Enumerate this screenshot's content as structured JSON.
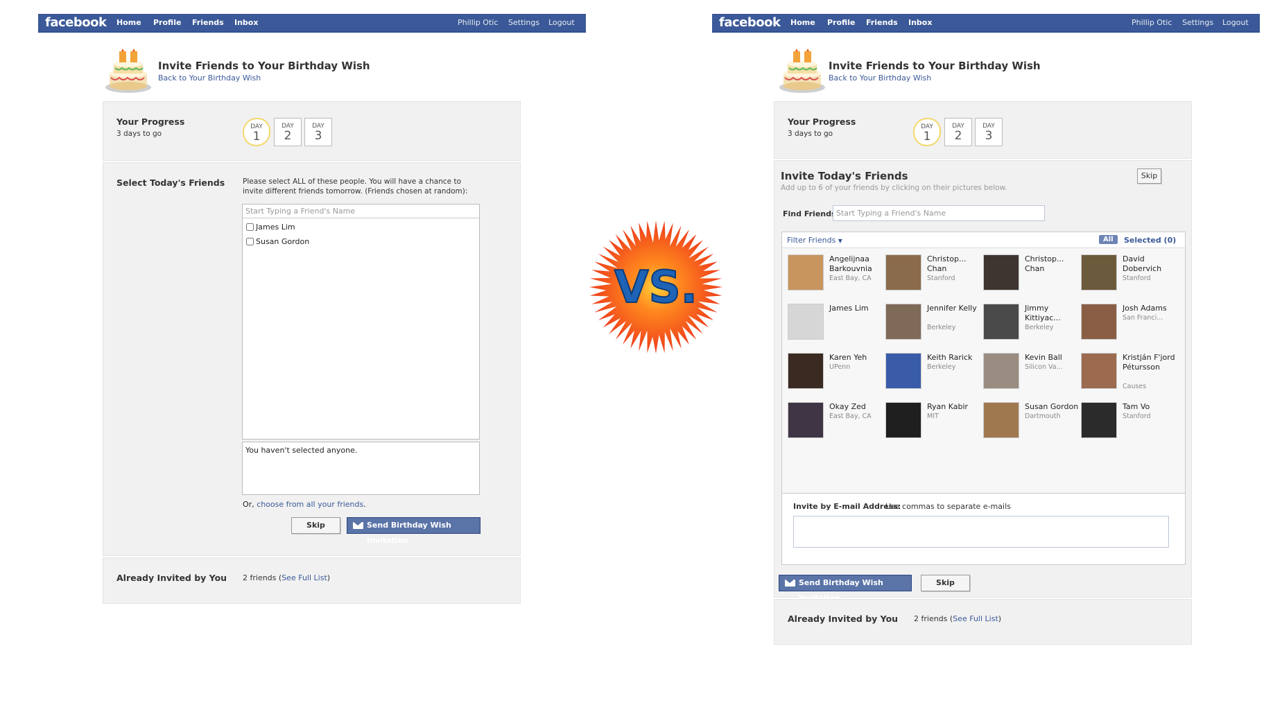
{
  "colors": {
    "brand": "#3b5998",
    "panel_bg": "#f1f1f1",
    "highlight_ring": "#f3d86a",
    "vs_fill": "#1e63b5",
    "burst": "#f04b1c"
  },
  "vs": {
    "text": "VS."
  },
  "left": {
    "topbar": {
      "logo": "facebook",
      "nav": [
        "Home",
        "Profile",
        "Friends",
        "Inbox"
      ],
      "right_nav": [
        "Phillip Otic",
        "Settings",
        "Logout"
      ]
    },
    "header": {
      "title": "Invite Friends to Your Birthday Wish",
      "back_link": "Back to Your Birthday Wish"
    },
    "progress": {
      "label": "Your Progress",
      "days_to_go": "3 days to go",
      "days": [
        {
          "label": "DAY",
          "num": "1",
          "current": true
        },
        {
          "label": "DAY",
          "num": "2"
        },
        {
          "label": "DAY",
          "num": "3"
        }
      ]
    },
    "select": {
      "label": "Select Today's Friends",
      "instructions": "Please select ALL of these people. You will have a chance to invite different friends tomorrow. (Friends chosen at random):",
      "search_placeholder": "Start Typing a Friend's Name",
      "friends": [
        "James Lim",
        "Susan Gordon"
      ],
      "selected_text": "You haven't selected anyone.",
      "or_text": "Or,",
      "choose_link": "choose from all your friends",
      "period": ".",
      "skip": "Skip",
      "send": "Send Birthday Wish Invitation"
    },
    "already": {
      "label": "Already Invited by You",
      "count": "2 friends",
      "open_paren": "(",
      "link": "See Full List",
      "close_paren": ")"
    }
  },
  "right": {
    "topbar": {
      "logo": "facebook",
      "nav": [
        "Home",
        "Profile",
        "Friends",
        "Inbox"
      ],
      "right_nav": [
        "Phillip Otic",
        "Settings",
        "Logout"
      ]
    },
    "header": {
      "title": "Invite Friends to Your Birthday Wish",
      "back_link": "Back to Your Birthday Wish"
    },
    "progress": {
      "label": "Your Progress",
      "days_to_go": "3 days to go",
      "days": [
        {
          "label": "DAY",
          "num": "1",
          "current": true
        },
        {
          "label": "DAY",
          "num": "2"
        },
        {
          "label": "DAY",
          "num": "3"
        }
      ]
    },
    "invite": {
      "title": "Invite Today's Friends",
      "subtitle": "Add up to 6 of your friends by clicking on their pictures below.",
      "skip_top": "Skip",
      "find_label": "Find Friends:",
      "find_placeholder": "Start Typing a Friend's Name",
      "filter": "Filter Friends",
      "all": "All",
      "selected": "Selected (0)",
      "friends": [
        {
          "name": "Angelijnaa Barkouvnia",
          "net": "East Bay, CA",
          "color": "#c9955f"
        },
        {
          "name": "Christop... Chan",
          "net": "Stanford",
          "color": "#8a6b4c"
        },
        {
          "name": "Christop... Chan",
          "net": "",
          "color": "#3e3530"
        },
        {
          "name": "David Dobervich",
          "net": "Stanford",
          "color": "#6b5a3b"
        },
        {
          "name": "James Lim",
          "net": "",
          "color": "#d6d6d6"
        },
        {
          "name": "Jennifer Kelly",
          "net": "Berkeley",
          "color": "#7f6a58"
        },
        {
          "name": "Jimmy Kittiyac...",
          "net": "Berkeley",
          "color": "#4a4a4a"
        },
        {
          "name": "Josh Adams",
          "net": "San Franci...",
          "color": "#8a5e45"
        },
        {
          "name": "Karen Yeh",
          "net": "UPenn",
          "color": "#3b2a22"
        },
        {
          "name": "Keith Rarick",
          "net": "Berkeley",
          "color": "#3a5ca8"
        },
        {
          "name": "Kevin Ball",
          "net": "Silicon Va...",
          "color": "#9a8c80"
        },
        {
          "name": "Kristján F'jord Pétursson",
          "net": "Causes",
          "color": "#9c6a4f"
        },
        {
          "name": "Okay Zed",
          "net": "East Bay, CA",
          "color": "#3f3545"
        },
        {
          "name": "Ryan Kabir",
          "net": "MIT",
          "color": "#1f1f1f"
        },
        {
          "name": "Susan Gordon",
          "net": "Dartmouth",
          "color": "#a07850"
        },
        {
          "name": "Tam Vo",
          "net": "Stanford",
          "color": "#2b2b2b"
        }
      ],
      "email_label": "Invite by E-mail Address:",
      "email_hint": "Use commas to separate e-mails",
      "send": "Send Birthday Wish Invitation",
      "skip": "Skip"
    },
    "already": {
      "label": "Already Invited by You",
      "count": "2 friends",
      "open_paren": "(",
      "link": "See Full List",
      "close_paren": ")"
    }
  }
}
